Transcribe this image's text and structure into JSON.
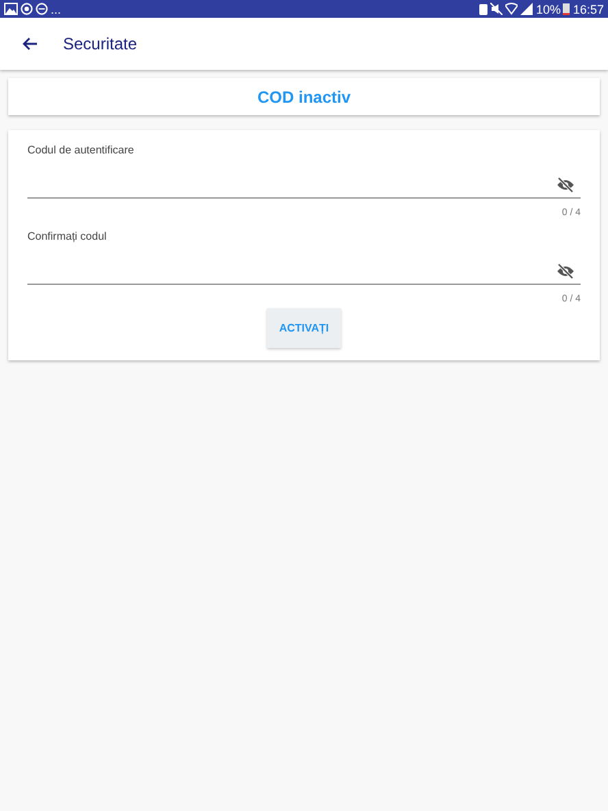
{
  "status_bar": {
    "overflow": "...",
    "battery": "10%",
    "time": "16:57"
  },
  "app_bar": {
    "title": "Securitate"
  },
  "status_card": {
    "text": "COD inactiv"
  },
  "fields": [
    {
      "label": "Codul de autentificare",
      "counter": "0 / 4"
    },
    {
      "label": "Confirmați codul",
      "counter": "0 / 4"
    }
  ],
  "button": "ACTIVAȚI"
}
